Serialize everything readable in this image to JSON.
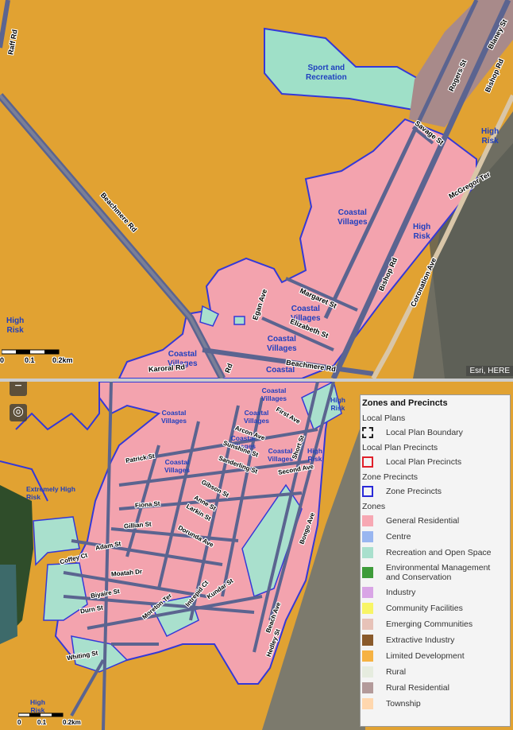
{
  "top_map": {
    "labels": {
      "sport": "Sport and\nRecreation",
      "coastal1": "Coastal\nVillages",
      "coastal2": "Coastal\nVillages",
      "coastal3": "Coastal\nVillages",
      "coastal4": "Coastal\nVillages",
      "coastal5": "Coastal",
      "high_risk1": "High\nRisk",
      "high_risk2": "High\nRisk",
      "high_risk3": "High\nRisk"
    },
    "roads": {
      "raff": "Raff Rd",
      "beachmere1": "Beachmere Rd",
      "beachmere2": "Beachmere Rd",
      "blaney": "Blaney St",
      "bishop1": "Bishop Rd",
      "rogers": "Rogers St",
      "savage": "Savage St",
      "mcgregor": "McGregor Ter",
      "bishop2": "Bishop Rd",
      "coronation": "Coronation Ave",
      "margaret": "Margaret St",
      "elizabeth": "Elizabeth St",
      "egan": "Egan Ave",
      "karoral": "Karoral Rd",
      "rd": "Rd"
    },
    "scale": {
      "zero": "0",
      "mid": "0.1",
      "end": "0.2km"
    },
    "attribution": "Esri, HERE"
  },
  "bottom_map": {
    "labels": {
      "coastal_a": "Coastal\nVillages",
      "coastal_b": "Coastal\nVillages",
      "coastal_c": "Coastal\nVillages",
      "coastal_d": "Coastal\nVillages",
      "coastal_e": "Coastal\nVillages",
      "coastal_f": "Coastal\nVillages",
      "high_risk_a": "High\nRisk",
      "high_risk_b": "High\nRisk",
      "high_risk_c": "High\nRisk",
      "extremely": "Extremely High\nRisk"
    },
    "roads": {
      "patrick": "Patrick St",
      "fiona": "Fiona St",
      "gillian": "Gillian St",
      "adam": "Adam St",
      "coffey": "Coffey Ct",
      "anne": "Anne St",
      "gibson": "Gibson St",
      "larkin": "Larkin St",
      "dorunda": "Dorunda Ave",
      "moatah": "Moatah Dr",
      "biyaire": "Biyaire St",
      "durn": "Durn St",
      "kundar": "Kundar St",
      "moreton": "Moreton Ter",
      "intrepid": "Intrepid Ct",
      "whiting": "Whiting St",
      "arcon": "Arcon Ave",
      "second": "Second Ave",
      "first": "First Ave",
      "short": "Short St",
      "bongo": "Bongo Ave",
      "sunshine": "Sunshine St",
      "sanderling": "Sanderling St",
      "beach_ave": "Beach Ave",
      "hedley": "Hedley St"
    },
    "scale": {
      "zero": "0",
      "mid": "0.1",
      "end": "0.2km"
    },
    "zoom_minus": "−",
    "locate": "◎"
  },
  "legend": {
    "title": "Zones and Precincts",
    "sections": {
      "local_plans": "Local Plans",
      "local_plan_precincts": "Local Plan Precincts",
      "zone_precincts": "Zone Precincts",
      "zones": "Zones"
    },
    "items": {
      "boundary": "Local Plan Boundary",
      "lp_precincts": "Local Plan Precincts",
      "z_precincts": "Zone Precincts"
    },
    "zones": [
      {
        "label": "General Residential",
        "color": "#f7a8b3"
      },
      {
        "label": "Centre",
        "color": "#99b6f0"
      },
      {
        "label": "Recreation and Open Space",
        "color": "#a9e0cd"
      },
      {
        "label": "Environmental Management\nand Conservation",
        "color": "#3e9c3a"
      },
      {
        "label": "Industry",
        "color": "#d9a5e6"
      },
      {
        "label": "Community Facilities",
        "color": "#f8f566"
      },
      {
        "label": "Emerging Communities",
        "color": "#e7c2b8"
      },
      {
        "label": "Extractive Industry",
        "color": "#8a5a2b"
      },
      {
        "label": "Limited Development",
        "color": "#f6b243"
      },
      {
        "label": "Rural",
        "color": "#e6ecdf"
      },
      {
        "label": "Rural Residential",
        "color": "#b39a9a"
      },
      {
        "label": "Township",
        "color": "#ffd7ae"
      }
    ]
  }
}
